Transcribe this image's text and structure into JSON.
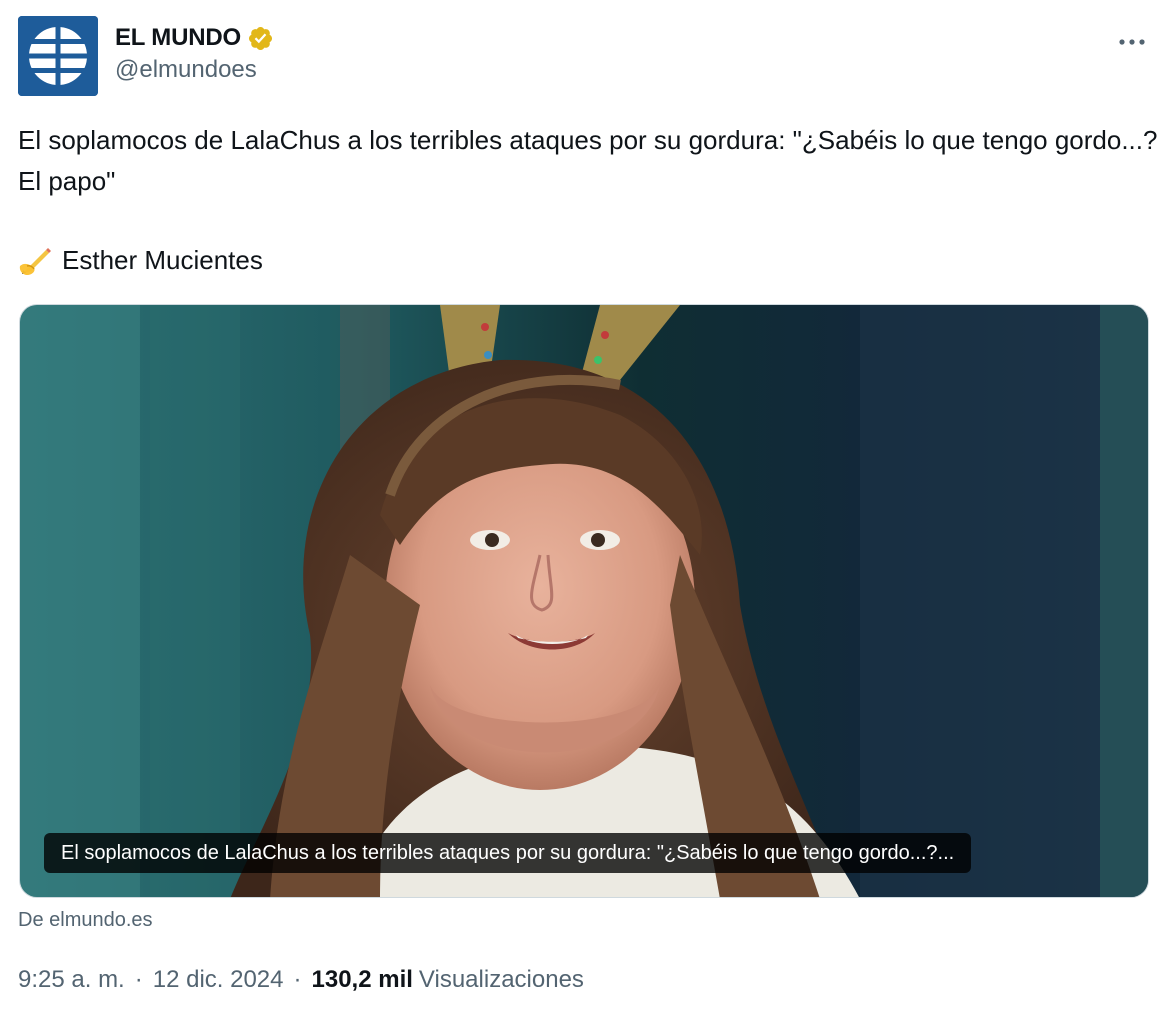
{
  "author": {
    "display_name": "EL MUNDO",
    "handle": "@elmundoes",
    "verified": true,
    "verified_color": "#e2b719",
    "avatar_icon": "el-mundo-globe-logo",
    "avatar_color": "#1e5c9a"
  },
  "more_icon": "more-horizontal-icon",
  "tweet": {
    "text": "El soplamocos de LalaChus a los terribles ataques por su gordura: \"¿Sabéis lo que tengo gordo...? El papo\"",
    "byline_icon": "writing-hand-icon",
    "byline_emoji": "✍️",
    "byline_name": "Esther Mucientes"
  },
  "media": {
    "caption": "El soplamocos de LalaChus a los terribles ataques por su gordura: \"¿Sabéis lo que tengo gordo...?...",
    "source": "De elmundo.es"
  },
  "meta": {
    "time": "9:25 a. m.",
    "separator": "·",
    "date": "12 dic. 2024",
    "views_count": "130,2 mil",
    "views_label": "Visualizaciones"
  }
}
